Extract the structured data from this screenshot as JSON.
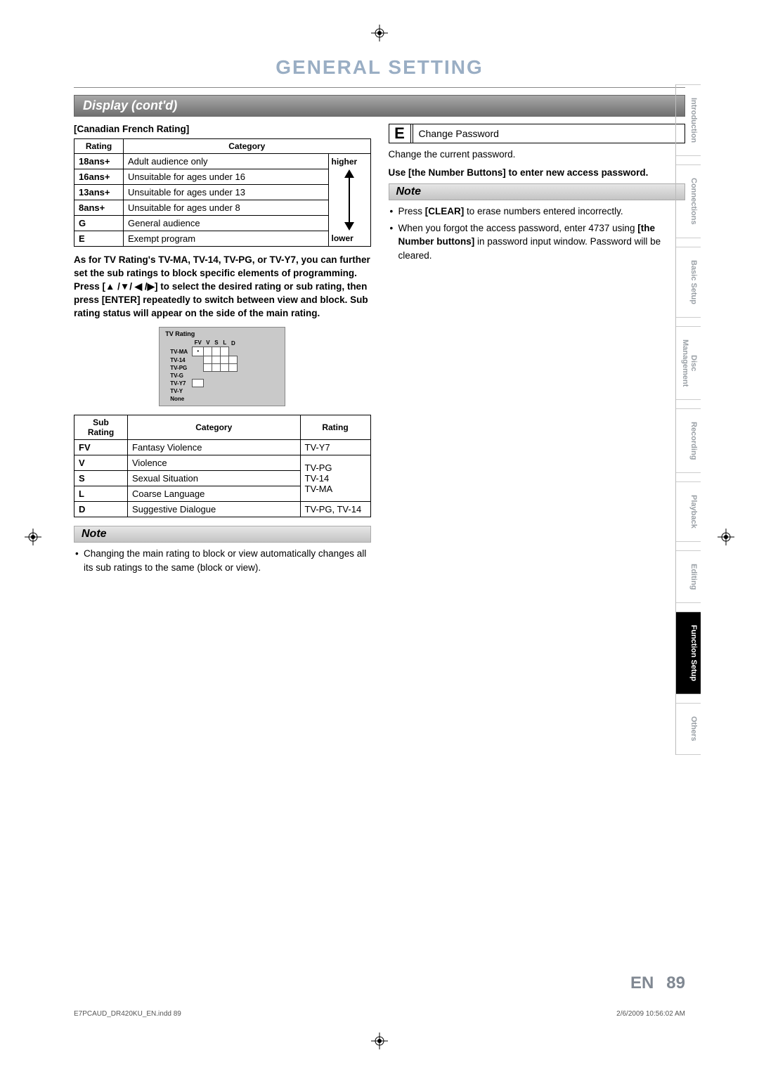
{
  "page_title": "GENERAL SETTING",
  "section_title": "Display (cont'd)",
  "canadian_french": {
    "heading": "[Canadian French Rating]",
    "headers": {
      "rating": "Rating",
      "category": "Category"
    },
    "higher": "higher",
    "lower": "lower",
    "rows": [
      {
        "rating": "18ans+",
        "category": "Adult audience only"
      },
      {
        "rating": "16ans+",
        "category": "Unsuitable for ages under 16"
      },
      {
        "rating": "13ans+",
        "category": "Unsuitable for ages under 13"
      },
      {
        "rating": "8ans+",
        "category": "Unsuitable for ages under 8"
      },
      {
        "rating": "G",
        "category": "General audience"
      },
      {
        "rating": "E",
        "category": "Exempt program"
      }
    ]
  },
  "desc_text": "As for TV Rating's TV-MA, TV-14, TV-PG, or TV-Y7, you can further set the sub ratings to block specific elements of programming. Press [▲ /▼/ ◀ /▶] to select the desired rating or sub rating, then press [ENTER] repeatedly to switch between view and block. Sub rating status will appear on the side of the main rating.",
  "tv_box": {
    "title": "TV Rating",
    "cols": [
      "FV",
      "V",
      "S",
      "L",
      "D"
    ],
    "rows": [
      "TV-MA",
      "TV-14",
      "TV-PG",
      "TV-G",
      "TV-Y7",
      "TV-Y",
      "None"
    ]
  },
  "sub_table": {
    "headers": {
      "sub": "Sub Rating",
      "cat": "Category",
      "rat": "Rating"
    },
    "rows": [
      {
        "sub": "FV",
        "cat": "Fantasy Violence",
        "rat": "TV-Y7"
      },
      {
        "sub": "V",
        "cat": "Violence",
        "rat": "TV-PG"
      },
      {
        "sub": "S",
        "cat": "Sexual Situation",
        "rat": "TV-14"
      },
      {
        "sub": "L",
        "cat": "Coarse Language",
        "rat": "TV-MA"
      },
      {
        "sub": "D",
        "cat": "Suggestive Dialogue",
        "rat": "TV-PG, TV-14"
      }
    ],
    "group_rat": "TV-PG\nTV-14\nTV-MA"
  },
  "note_left": {
    "heading": "Note",
    "items": [
      "Changing the main rating to block or view automatically changes all its sub ratings to the same (block or view)."
    ]
  },
  "e_section": {
    "letter": "E",
    "title": "Change Password",
    "desc": "Change the current password.",
    "instruction": "Use [the Number Buttons] to enter new access password."
  },
  "note_right": {
    "heading": "Note",
    "items": [
      {
        "pre": "Press ",
        "b": "[CLEAR]",
        "post": " to erase numbers entered incorrectly."
      },
      {
        "pre": "When you forgot the access password, enter 4737 using ",
        "b": "[the Number buttons]",
        "post": " in password input window. Password will be cleared."
      }
    ]
  },
  "tabs": [
    {
      "label": "Introduction",
      "active": false
    },
    {
      "label": "Connections",
      "active": false
    },
    {
      "label": "Basic Setup",
      "active": false
    },
    {
      "label": "Disc\nManagement",
      "active": false
    },
    {
      "label": "Recording",
      "active": false
    },
    {
      "label": "Playback",
      "active": false
    },
    {
      "label": "Editing",
      "active": false
    },
    {
      "label": "Function Setup",
      "active": true
    },
    {
      "label": "Others",
      "active": false
    }
  ],
  "page_number": {
    "lang": "EN",
    "num": "89"
  },
  "footer_left": "E7PCAUD_DR420KU_EN.indd   89",
  "footer_right": "2/6/2009   10:56:02 AM"
}
